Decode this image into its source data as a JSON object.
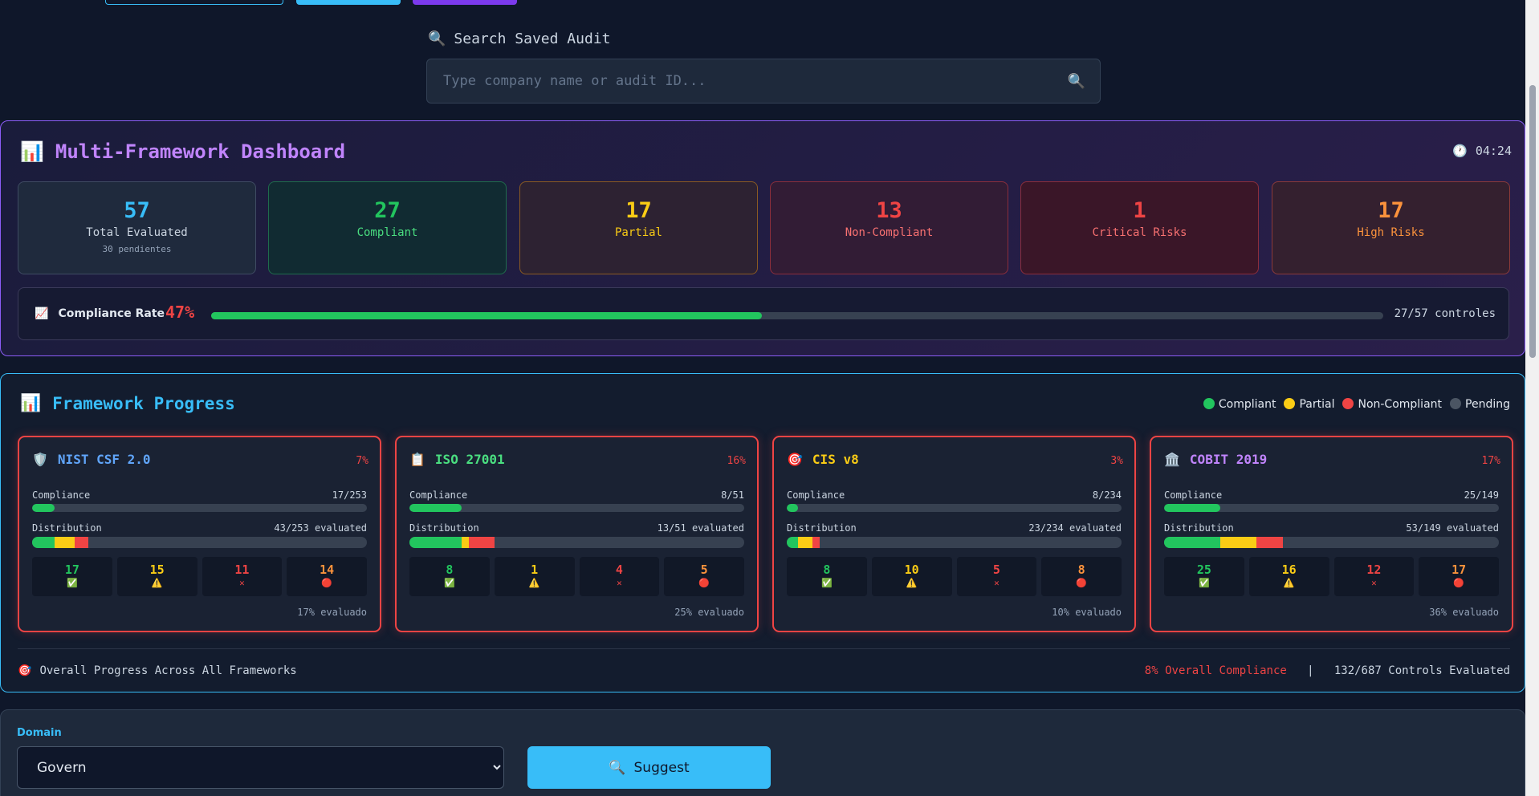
{
  "search": {
    "label": "Search Saved Audit",
    "placeholder": "Type company name or audit ID...",
    "icon": "search-icon"
  },
  "dashboard": {
    "title": "Multi-Framework Dashboard",
    "clock": "04:24",
    "stats": [
      {
        "value": "57",
        "label": "Total Evaluated",
        "sub": "30 pendientes",
        "color": "#38bdf8"
      },
      {
        "value": "27",
        "label": "Compliant",
        "color": "#22c55e"
      },
      {
        "value": "17",
        "label": "Partial",
        "color": "#facc15"
      },
      {
        "value": "13",
        "label": "Non-Compliant",
        "color": "#ef4444"
      },
      {
        "value": "1",
        "label": "Critical Risks",
        "color": "#ef4444"
      },
      {
        "value": "17",
        "label": "High Risks",
        "color": "#fb923c"
      }
    ],
    "compliance": {
      "label": "Compliance Rate",
      "percent": "47%",
      "bar_fraction": 0.47,
      "count": "27/57 controles"
    }
  },
  "frameworks": {
    "title": "Framework Progress",
    "legend": [
      {
        "label": "Compliant",
        "color": "#22c55e"
      },
      {
        "label": "Partial",
        "color": "#facc15"
      },
      {
        "label": "Non-Compliant",
        "color": "#ef4444"
      },
      {
        "label": "Pending",
        "color": "#4b5563"
      }
    ],
    "compliance_label": "Compliance",
    "distribution_label": "Distribution",
    "cards": [
      {
        "name": "NIST CSF 2.0",
        "icon": "shield-icon",
        "color": "#60a5fa",
        "percent": "7%",
        "compliance": "17/253",
        "distribution": "43/253 evaluated",
        "compliant": "17",
        "partial": "15",
        "noncompliant": "11",
        "risks": "14",
        "evaluated": "17% evaluado",
        "c_frac": 0.067,
        "d": [
          0.067,
          0.059,
          0.043
        ]
      },
      {
        "name": "ISO 27001",
        "icon": "clipboard-icon",
        "color": "#4ade80",
        "percent": "16%",
        "compliance": "8/51",
        "distribution": "13/51 evaluated",
        "compliant": "8",
        "partial": "1",
        "noncompliant": "4",
        "risks": "5",
        "evaluated": "25% evaluado",
        "c_frac": 0.157,
        "d": [
          0.157,
          0.02,
          0.078
        ]
      },
      {
        "name": "CIS v8",
        "icon": "target-icon",
        "color": "#facc15",
        "percent": "3%",
        "compliance": "8/234",
        "distribution": "23/234 evaluated",
        "compliant": "8",
        "partial": "10",
        "noncompliant": "5",
        "risks": "8",
        "evaluated": "10% evaluado",
        "c_frac": 0.034,
        "d": [
          0.034,
          0.043,
          0.021
        ]
      },
      {
        "name": "COBIT 2019",
        "icon": "bank-icon",
        "color": "#c084fc",
        "percent": "17%",
        "compliance": "25/149",
        "distribution": "53/149 evaluated",
        "compliant": "25",
        "partial": "16",
        "noncompliant": "12",
        "risks": "17",
        "evaluated": "36% evaluado",
        "c_frac": 0.168,
        "d": [
          0.168,
          0.107,
          0.081
        ]
      }
    ],
    "footer": {
      "label": "Overall Progress Across All Frameworks",
      "overall": "8% Overall Compliance",
      "sep": "|",
      "evaluated": "132/687 Controls Evaluated"
    }
  },
  "domain": {
    "label": "Domain",
    "selected": "Govern",
    "button": "Suggest"
  }
}
